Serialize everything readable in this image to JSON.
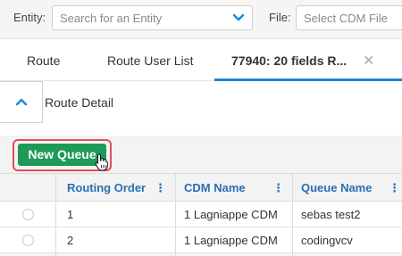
{
  "filters": {
    "entity_label": "Entity:",
    "entity_placeholder": "Search for an Entity",
    "file_label": "File:",
    "file_placeholder": "Select CDM File"
  },
  "tabs": [
    {
      "label": "Route"
    },
    {
      "label": "Route User List"
    },
    {
      "label": "77940: 20 fields R..."
    }
  ],
  "tab_close": "✕",
  "detail": {
    "title": "Route Detail"
  },
  "toolbar": {
    "new_queue_label": "New Queue"
  },
  "table": {
    "columns": [
      "Routing Order",
      "CDM Name",
      "Queue Name"
    ],
    "column_menu": "⋮",
    "rows": [
      {
        "order": "1",
        "cdm": "1 Lagniappe CDM",
        "queue": "sebas test2"
      },
      {
        "order": "2",
        "cdm": "1 Lagniappe CDM",
        "queue": "codingvcv"
      }
    ]
  },
  "colors": {
    "accent": "#1e88d4",
    "primary_button": "#1e9a58",
    "highlight": "#e0505a",
    "header_text": "#2a6fb4"
  }
}
